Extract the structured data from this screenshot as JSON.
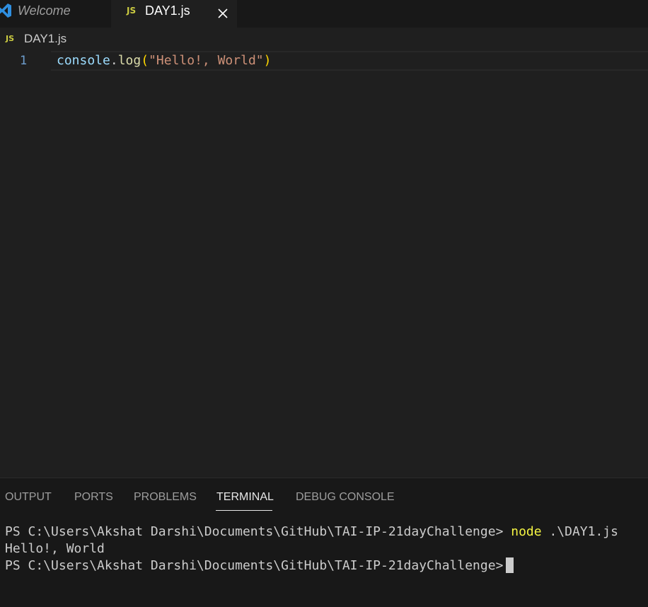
{
  "tabs": {
    "welcome_label": "Welcome",
    "active_label": "DAY1.js",
    "active_badge": "JS"
  },
  "breadcrumb": {
    "badge": "JS",
    "file": "DAY1.js"
  },
  "editor": {
    "line_number": "1",
    "tokens": {
      "object": "console",
      "dot": ".",
      "method": "log",
      "open_paren": "(",
      "string": "\"Hello!, World\"",
      "close_paren": ")"
    }
  },
  "panel": {
    "tabs": [
      "OUTPUT",
      "PORTS",
      "PROBLEMS",
      "TERMINAL",
      "DEBUG CONSOLE"
    ],
    "active_tab": "TERMINAL"
  },
  "terminal": {
    "prompt": "PS C:\\Users\\Akshat Darshi\\Documents\\GitHub\\TAI-IP-21dayChallenge> ",
    "command": "node",
    "command_args": " .\\DAY1.js",
    "output": "Hello!, World",
    "prompt2": "PS C:\\Users\\Akshat Darshi\\Documents\\GitHub\\TAI-IP-21dayChallenge>"
  },
  "colors": {
    "editor_bg": "#1f1f1f",
    "tabbar_bg": "#181818",
    "js_badge": "#cbcb41",
    "string": "#ce9178",
    "function": "#dcdcaa",
    "variable": "#9cdcfe",
    "bracket": "#ffd700",
    "terminal_command": "#f5f543"
  }
}
